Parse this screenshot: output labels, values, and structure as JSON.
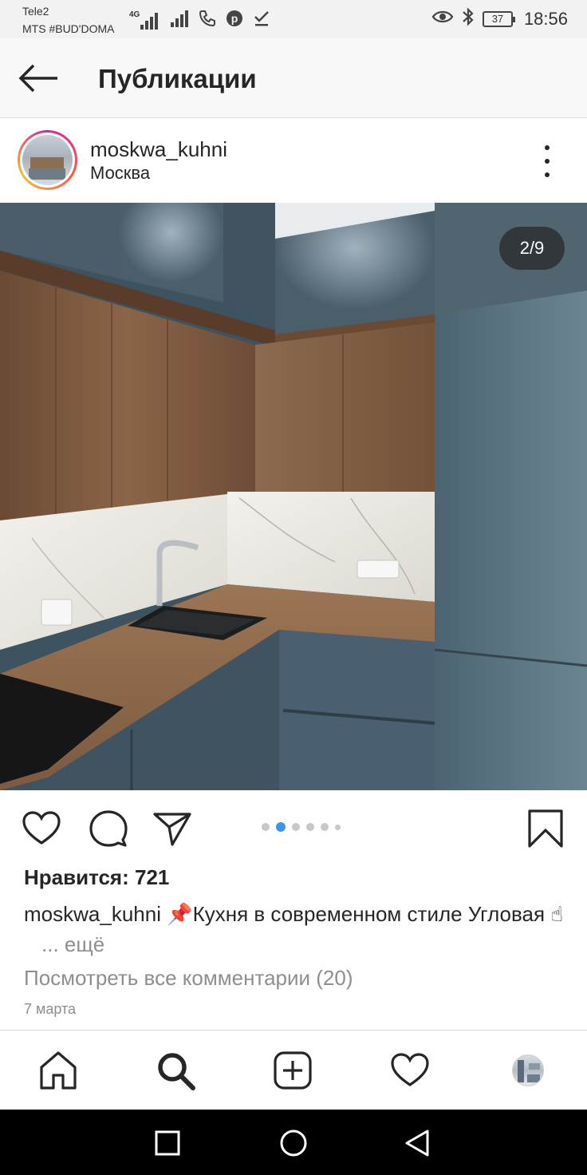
{
  "status_bar": {
    "carrier_1": "Tele2",
    "carrier_2": "MTS #BUD'DOMA",
    "network_type": "4G",
    "battery": "37",
    "time": "18:56",
    "icons_left": [
      "signal-icon",
      "signal-icon",
      "wifi-call-icon",
      "pinterest-icon",
      "download-done-icon"
    ],
    "icons_right": [
      "eye-icon",
      "bluetooth-icon",
      "battery-icon"
    ]
  },
  "app_bar": {
    "title": "Публикации",
    "back_icon": "arrow-left-icon"
  },
  "post": {
    "username": "moskwa_kuhni",
    "location": "Москва",
    "image_counter": "2/9",
    "carousel": {
      "total_dots": 6,
      "active_index": 1
    },
    "likes_text": "Нравится: 721",
    "caption_user": "moskwa_kuhni",
    "caption_text": "📌Кухня в современном стиле Угловая ☝",
    "caption_more": "... ещё",
    "view_comments": "Посмотреть все комментарии (20)",
    "date": "7 марта"
  },
  "colors": {
    "accent_blue": "#3897f0",
    "text_primary": "#262626",
    "text_secondary": "#8e8e8e"
  },
  "tab_bar": {
    "items": [
      "home-icon",
      "search-icon",
      "add-post-icon",
      "activity-heart-icon",
      "profile-avatar"
    ]
  },
  "system_nav": {
    "items": [
      "recents-square-icon",
      "home-circle-icon",
      "back-triangle-icon"
    ]
  }
}
